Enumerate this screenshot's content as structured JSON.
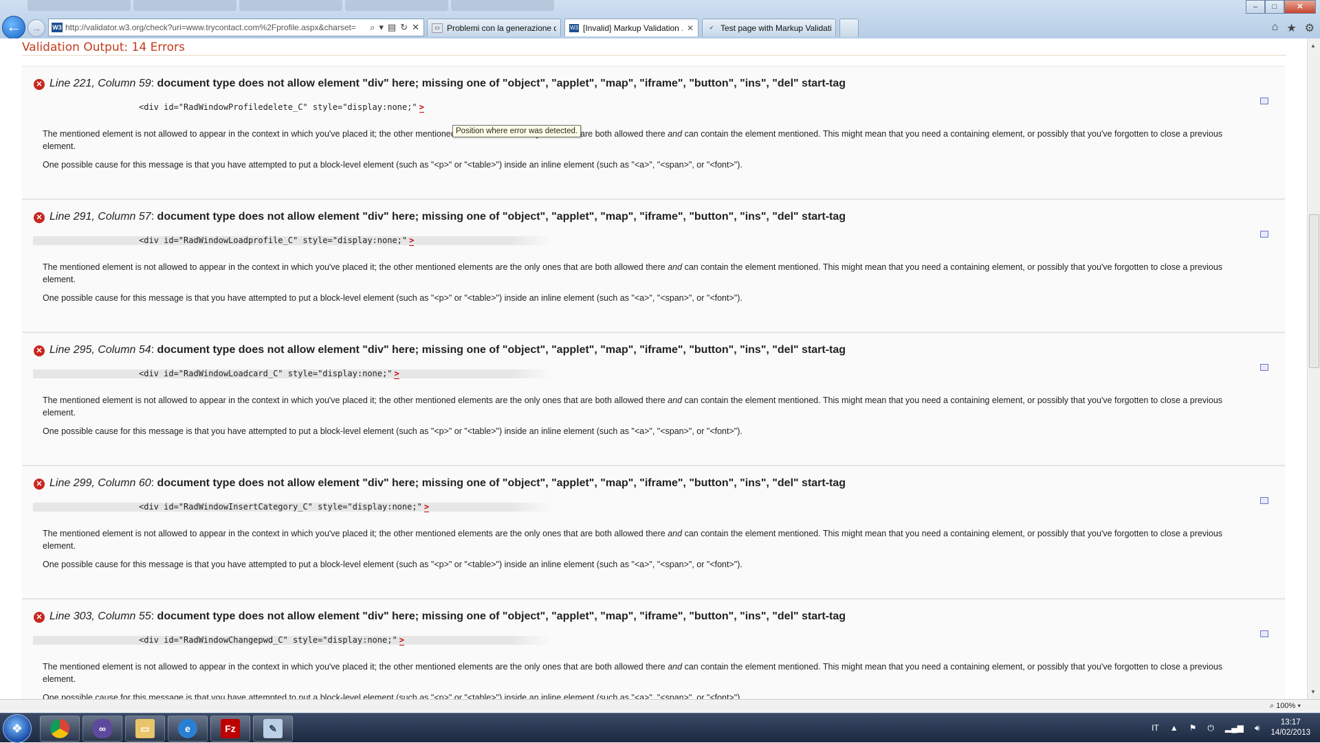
{
  "browser": {
    "address_url": "http://validator.w3.org/check?uri=www.trycontact.com%2Fprofile.aspx&charset=",
    "tabs": [
      {
        "label": "Problemi con la generazione d...",
        "active": false
      },
      {
        "label": "[Invalid] Markup Validation ...",
        "active": true
      },
      {
        "label": "Test page with Markup Validati...",
        "active": false
      }
    ],
    "icons": {
      "back": "back-arrow-icon",
      "forward": "forward-arrow-icon",
      "home": "home-icon",
      "favorites": "star-icon",
      "tools": "gear-icon"
    }
  },
  "page": {
    "title": "Validation Output: 14 Errors",
    "tooltip": "Position where error was detected.",
    "errors": [
      {
        "location": "Line 221, Column 59",
        "message": "document type does not allow element \"div\" here; missing one of \"object\", \"applet\", \"map\", \"iframe\", \"button\", \"ins\", \"del\" start-tag",
        "code": "<div id=\"RadWindowProfiledelete_C\" style=\"display:none;\"",
        "marker": ">",
        "explanation": "The mentioned element is not allowed to appear in the context in which you've placed it; the other mentioned elements are the only ones that are both allowed there",
        "explanation_em": "and",
        "explanation_tail": "can contain the element mentioned. This might mean that you need a containing element, or possibly that you've forgotten to close a previous element.",
        "cause": "One possible cause for this message is that you have attempted to put a block-level element (such as \"<p>\" or \"<table>\") inside an inline element (such as \"<a>\", \"<span>\", or \"<font>\")."
      },
      {
        "location": "Line 291, Column 57",
        "message": "document type does not allow element \"div\" here; missing one of \"object\", \"applet\", \"map\", \"iframe\", \"button\", \"ins\", \"del\" start-tag",
        "code": "<div id=\"RadWindowLoadprofile_C\" style=\"display:none;\"",
        "marker": ">",
        "explanation": "The mentioned element is not allowed to appear in the context in which you've placed it; the other mentioned elements are the only ones that are both allowed there",
        "explanation_em": "and",
        "explanation_tail": "can contain the element mentioned. This might mean that you need a containing element, or possibly that you've forgotten to close a previous element.",
        "cause": "One possible cause for this message is that you have attempted to put a block-level element (such as \"<p>\" or \"<table>\") inside an inline element (such as \"<a>\", \"<span>\", or \"<font>\")."
      },
      {
        "location": "Line 295, Column 54",
        "message": "document type does not allow element \"div\" here; missing one of \"object\", \"applet\", \"map\", \"iframe\", \"button\", \"ins\", \"del\" start-tag",
        "code": "<div id=\"RadWindowLoadcard_C\" style=\"display:none;\"",
        "marker": ">",
        "explanation": "The mentioned element is not allowed to appear in the context in which you've placed it; the other mentioned elements are the only ones that are both allowed there",
        "explanation_em": "and",
        "explanation_tail": "can contain the element mentioned. This might mean that you need a containing element, or possibly that you've forgotten to close a previous element.",
        "cause": "One possible cause for this message is that you have attempted to put a block-level element (such as \"<p>\" or \"<table>\") inside an inline element (such as \"<a>\", \"<span>\", or \"<font>\")."
      },
      {
        "location": "Line 299, Column 60",
        "message": "document type does not allow element \"div\" here; missing one of \"object\", \"applet\", \"map\", \"iframe\", \"button\", \"ins\", \"del\" start-tag",
        "code": "<div id=\"RadWindowInsertCategory_C\" style=\"display:none;\"",
        "marker": ">",
        "explanation": "The mentioned element is not allowed to appear in the context in which you've placed it; the other mentioned elements are the only ones that are both allowed there",
        "explanation_em": "and",
        "explanation_tail": "can contain the element mentioned. This might mean that you need a containing element, or possibly that you've forgotten to close a previous element.",
        "cause": "One possible cause for this message is that you have attempted to put a block-level element (such as \"<p>\" or \"<table>\") inside an inline element (such as \"<a>\", \"<span>\", or \"<font>\")."
      },
      {
        "location": "Line 303, Column 55",
        "message": "document type does not allow element \"div\" here; missing one of \"object\", \"applet\", \"map\", \"iframe\", \"button\", \"ins\", \"del\" start-tag",
        "code": "<div id=\"RadWindowChangepwd_C\" style=\"display:none;\"",
        "marker": ">",
        "explanation": "The mentioned element is not allowed to appear in the context in which you've placed it; the other mentioned elements are the only ones that are both allowed there",
        "explanation_em": "and",
        "explanation_tail": "can contain the element mentioned. This might mean that you need a containing element, or possibly that you've forgotten to close a previous element.",
        "cause": "One possible cause for this message is that you have attempted to put a block-level element (such as \"<p>\" or \"<table>\") inside an inline element (such as \"<a>\", \"<span>\", or \"<font>\")."
      }
    ]
  },
  "statusbar": {
    "zoom": "100%"
  },
  "taskbar": {
    "apps": [
      "chrome-icon",
      "visual-studio-icon",
      "explorer-folder-icon",
      "internet-explorer-icon",
      "filezilla-icon",
      "notepad-icon"
    ],
    "language": "IT",
    "time": "13:17",
    "date": "14/02/2013"
  },
  "colors": {
    "title": "#c43a1b",
    "error_icon": "#c7271e",
    "marker": "#cc0000"
  }
}
